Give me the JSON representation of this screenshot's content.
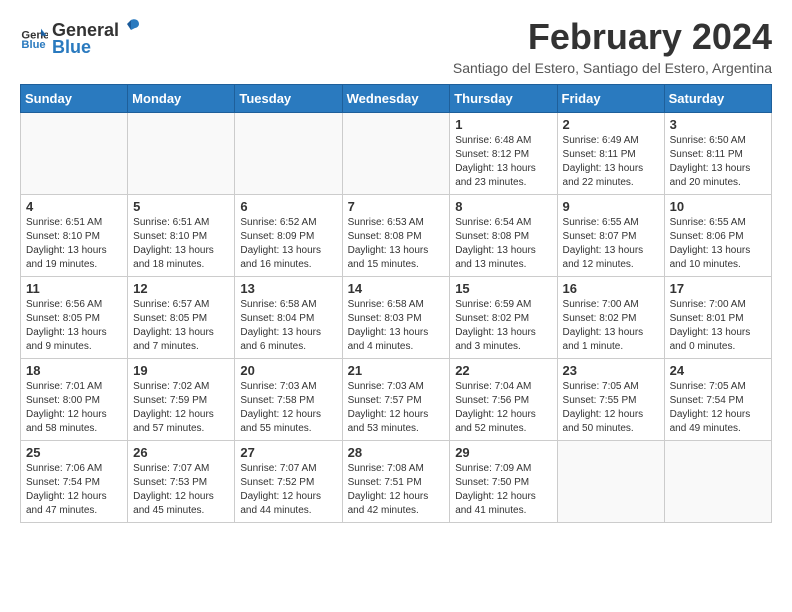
{
  "logo": {
    "general": "General",
    "blue": "Blue"
  },
  "title": "February 2024",
  "subtitle": "Santiago del Estero, Santiago del Estero, Argentina",
  "weekdays": [
    "Sunday",
    "Monday",
    "Tuesday",
    "Wednesday",
    "Thursday",
    "Friday",
    "Saturday"
  ],
  "weeks": [
    [
      {
        "day": "",
        "info": ""
      },
      {
        "day": "",
        "info": ""
      },
      {
        "day": "",
        "info": ""
      },
      {
        "day": "",
        "info": ""
      },
      {
        "day": "1",
        "info": "Sunrise: 6:48 AM\nSunset: 8:12 PM\nDaylight: 13 hours and 23 minutes."
      },
      {
        "day": "2",
        "info": "Sunrise: 6:49 AM\nSunset: 8:11 PM\nDaylight: 13 hours and 22 minutes."
      },
      {
        "day": "3",
        "info": "Sunrise: 6:50 AM\nSunset: 8:11 PM\nDaylight: 13 hours and 20 minutes."
      }
    ],
    [
      {
        "day": "4",
        "info": "Sunrise: 6:51 AM\nSunset: 8:10 PM\nDaylight: 13 hours and 19 minutes."
      },
      {
        "day": "5",
        "info": "Sunrise: 6:51 AM\nSunset: 8:10 PM\nDaylight: 13 hours and 18 minutes."
      },
      {
        "day": "6",
        "info": "Sunrise: 6:52 AM\nSunset: 8:09 PM\nDaylight: 13 hours and 16 minutes."
      },
      {
        "day": "7",
        "info": "Sunrise: 6:53 AM\nSunset: 8:08 PM\nDaylight: 13 hours and 15 minutes."
      },
      {
        "day": "8",
        "info": "Sunrise: 6:54 AM\nSunset: 8:08 PM\nDaylight: 13 hours and 13 minutes."
      },
      {
        "day": "9",
        "info": "Sunrise: 6:55 AM\nSunset: 8:07 PM\nDaylight: 13 hours and 12 minutes."
      },
      {
        "day": "10",
        "info": "Sunrise: 6:55 AM\nSunset: 8:06 PM\nDaylight: 13 hours and 10 minutes."
      }
    ],
    [
      {
        "day": "11",
        "info": "Sunrise: 6:56 AM\nSunset: 8:05 PM\nDaylight: 13 hours and 9 minutes."
      },
      {
        "day": "12",
        "info": "Sunrise: 6:57 AM\nSunset: 8:05 PM\nDaylight: 13 hours and 7 minutes."
      },
      {
        "day": "13",
        "info": "Sunrise: 6:58 AM\nSunset: 8:04 PM\nDaylight: 13 hours and 6 minutes."
      },
      {
        "day": "14",
        "info": "Sunrise: 6:58 AM\nSunset: 8:03 PM\nDaylight: 13 hours and 4 minutes."
      },
      {
        "day": "15",
        "info": "Sunrise: 6:59 AM\nSunset: 8:02 PM\nDaylight: 13 hours and 3 minutes."
      },
      {
        "day": "16",
        "info": "Sunrise: 7:00 AM\nSunset: 8:02 PM\nDaylight: 13 hours and 1 minute."
      },
      {
        "day": "17",
        "info": "Sunrise: 7:00 AM\nSunset: 8:01 PM\nDaylight: 13 hours and 0 minutes."
      }
    ],
    [
      {
        "day": "18",
        "info": "Sunrise: 7:01 AM\nSunset: 8:00 PM\nDaylight: 12 hours and 58 minutes."
      },
      {
        "day": "19",
        "info": "Sunrise: 7:02 AM\nSunset: 7:59 PM\nDaylight: 12 hours and 57 minutes."
      },
      {
        "day": "20",
        "info": "Sunrise: 7:03 AM\nSunset: 7:58 PM\nDaylight: 12 hours and 55 minutes."
      },
      {
        "day": "21",
        "info": "Sunrise: 7:03 AM\nSunset: 7:57 PM\nDaylight: 12 hours and 53 minutes."
      },
      {
        "day": "22",
        "info": "Sunrise: 7:04 AM\nSunset: 7:56 PM\nDaylight: 12 hours and 52 minutes."
      },
      {
        "day": "23",
        "info": "Sunrise: 7:05 AM\nSunset: 7:55 PM\nDaylight: 12 hours and 50 minutes."
      },
      {
        "day": "24",
        "info": "Sunrise: 7:05 AM\nSunset: 7:54 PM\nDaylight: 12 hours and 49 minutes."
      }
    ],
    [
      {
        "day": "25",
        "info": "Sunrise: 7:06 AM\nSunset: 7:54 PM\nDaylight: 12 hours and 47 minutes."
      },
      {
        "day": "26",
        "info": "Sunrise: 7:07 AM\nSunset: 7:53 PM\nDaylight: 12 hours and 45 minutes."
      },
      {
        "day": "27",
        "info": "Sunrise: 7:07 AM\nSunset: 7:52 PM\nDaylight: 12 hours and 44 minutes."
      },
      {
        "day": "28",
        "info": "Sunrise: 7:08 AM\nSunset: 7:51 PM\nDaylight: 12 hours and 42 minutes."
      },
      {
        "day": "29",
        "info": "Sunrise: 7:09 AM\nSunset: 7:50 PM\nDaylight: 12 hours and 41 minutes."
      },
      {
        "day": "",
        "info": ""
      },
      {
        "day": "",
        "info": ""
      }
    ]
  ]
}
